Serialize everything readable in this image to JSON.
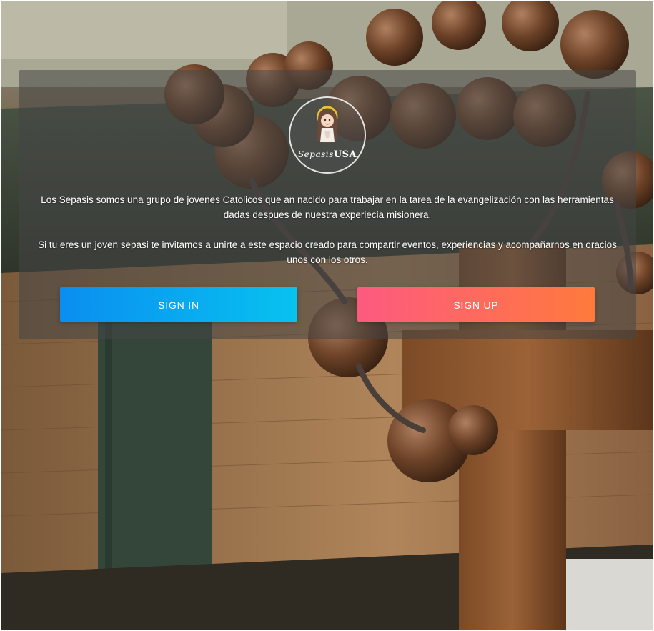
{
  "logo": {
    "icon": "virgin-mary-icon",
    "text_script": "Sepasis",
    "text_bold": "USA"
  },
  "intro": {
    "paragraph1": "Los Sepasis somos una grupo de jovenes Catolicos que an nacido para trabajar en la tarea de la evangelización con las herramientas dadas despues de nuestra experiecia misionera.",
    "paragraph2": "Si tu eres un joven sepasi te invitamos a unirte a este espacio creado para compartir eventos, experiencias y acompañarnos en oracios unos con los otros."
  },
  "actions": {
    "signin_label": "SIGN IN",
    "signup_label": "SIGN UP"
  },
  "colors": {
    "signin_start": "#0a8ef0",
    "signin_end": "#08c2ef",
    "signup_start": "#fd5a80",
    "signup_end": "#fe7a3c"
  }
}
